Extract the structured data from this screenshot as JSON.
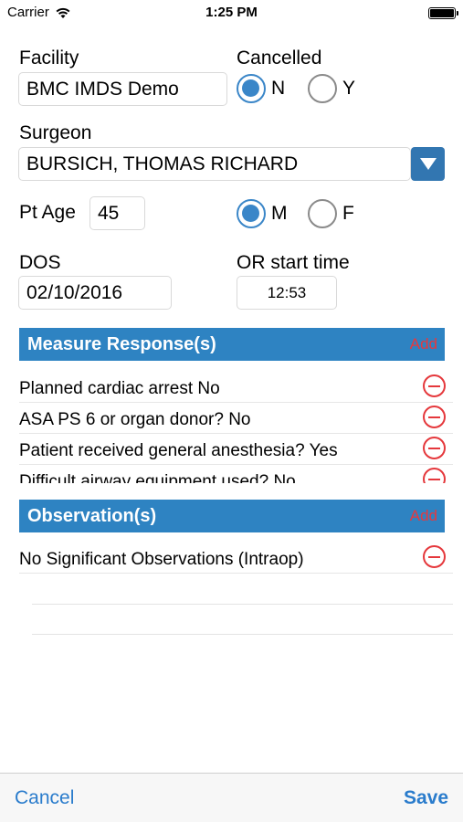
{
  "status_bar": {
    "carrier": "Carrier",
    "time": "1:25 PM"
  },
  "form": {
    "facility_label": "Facility",
    "facility_value": "BMC IMDS Demo",
    "cancelled_label": "Cancelled",
    "cancelled_options": {
      "no": "N",
      "yes": "Y",
      "selected": "N"
    },
    "surgeon_label": "Surgeon",
    "surgeon_value": "BURSICH, THOMAS RICHARD",
    "pt_age_label": "Pt Age",
    "pt_age_value": "45",
    "sex_options": {
      "male": "M",
      "female": "F",
      "selected": "M"
    },
    "dos_label": "DOS",
    "dos_value": "02/10/2016",
    "or_start_label": "OR start time",
    "or_start_value": "12:53"
  },
  "measure_responses": {
    "title": "Measure Response(s)",
    "add_label": "Add",
    "items": [
      "Planned cardiac arrest No",
      "ASA PS 6 or organ donor? No",
      "Patient received general anesthesia? Yes",
      "Difficult airway equipment used? No"
    ]
  },
  "observations": {
    "title": "Observation(s)",
    "add_label": "Add",
    "items": [
      "No Significant Observations (Intraop)"
    ]
  },
  "toolbar": {
    "cancel_label": "Cancel",
    "save_label": "Save"
  },
  "colors": {
    "accent": "#2e83c2",
    "danger": "#e5383c",
    "link": "#2a7ccc"
  }
}
